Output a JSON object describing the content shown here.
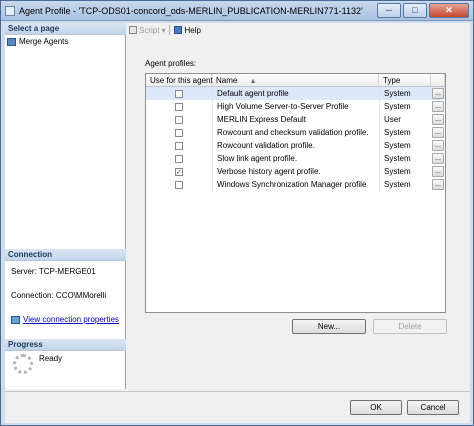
{
  "window": {
    "title": "Agent Profile - 'TCP-ODS01-concord_ods-MERLIN_PUBLICATION-MERLIN771-1132'",
    "minimize": "─",
    "maximize": "□",
    "close": "✕"
  },
  "left": {
    "select_page_header": "Select a page",
    "pages": [
      {
        "label": "Merge Agents",
        "icon": "page-icon"
      }
    ],
    "connection_header": "Connection",
    "server_line": "Server: TCP-MERGE01",
    "connection_line": "Connection: CCO\\MMorelli",
    "view_connection_link": "View connection properties",
    "progress_header": "Progress",
    "progress_status": "Ready"
  },
  "toolbar": {
    "script_label": "Script",
    "script_dropdown": "▾",
    "help_label": "Help"
  },
  "profiles": {
    "group_label": "Agent profiles:",
    "columns": [
      "Use for this agent",
      "Name",
      "Type"
    ],
    "sort_indicator": "▲",
    "rows": [
      {
        "checked": false,
        "name": "Default agent profile",
        "type": "System",
        "selected": true
      },
      {
        "checked": false,
        "name": "High Volume Server-to-Server Profile",
        "type": "System"
      },
      {
        "checked": false,
        "name": "MERLIN Express Default",
        "type": "User"
      },
      {
        "checked": false,
        "name": "Rowcount and checksum validation profile.",
        "type": "System"
      },
      {
        "checked": false,
        "name": "Rowcount validation profile.",
        "type": "System"
      },
      {
        "checked": false,
        "name": "Slow link agent profile.",
        "type": "System"
      },
      {
        "checked": true,
        "name": "Verbose history agent profile.",
        "type": "System"
      },
      {
        "checked": false,
        "name": "Windows Synchronization Manager profile",
        "type": "System"
      }
    ],
    "row_button": "...",
    "check_mark": "✓"
  },
  "buttons": {
    "new": "New...",
    "delete": "Delete",
    "ok": "OK",
    "cancel": "Cancel"
  },
  "colors": {
    "title_gradient": "#a9c1e0",
    "selected_row": "#dde8fb",
    "link": "#0000cc"
  }
}
